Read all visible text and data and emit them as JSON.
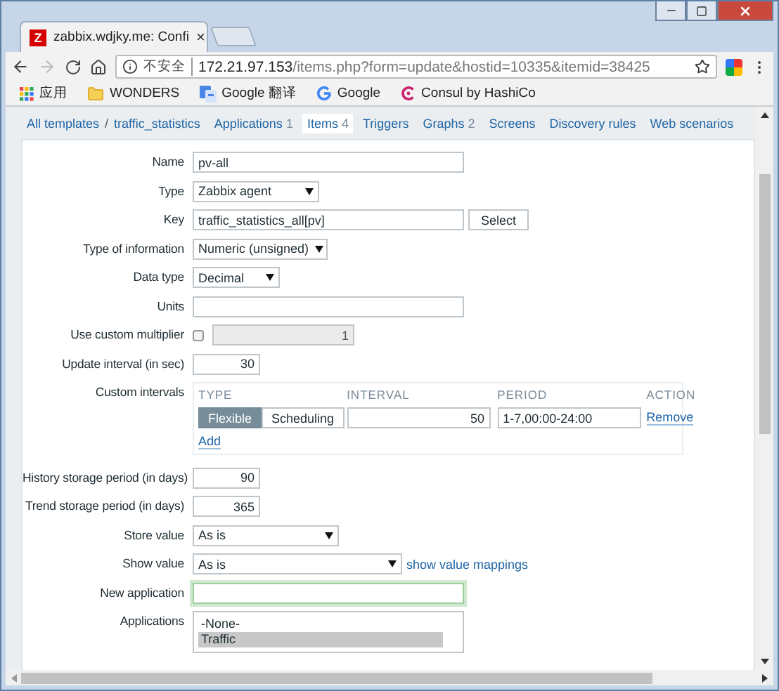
{
  "browser": {
    "tab": {
      "favicon": "Z",
      "title": "zabbix.wdjky.me: Confi",
      "close": "×"
    },
    "address": {
      "security": "不安全",
      "host": "172.21.97.153",
      "path": "/items.php?form=update&hostid=10335&itemid=38425"
    },
    "bookmarks": [
      {
        "kind": "apps",
        "label": "应用"
      },
      {
        "kind": "folder",
        "label": "WONDERS"
      },
      {
        "kind": "translate",
        "label": "Google 翻译"
      },
      {
        "kind": "google",
        "label": "Google"
      },
      {
        "kind": "consul",
        "label": "Consul by HashiCo"
      }
    ]
  },
  "nav": [
    {
      "label": "All templates",
      "selected": false
    },
    {
      "label": "traffic_statistics",
      "selected": false,
      "separator": "/"
    },
    {
      "label": "Applications",
      "count": "1",
      "selected": false
    },
    {
      "label": "Items",
      "count": "4",
      "selected": true
    },
    {
      "label": "Triggers",
      "selected": false
    },
    {
      "label": "Graphs",
      "count": "2",
      "selected": false
    },
    {
      "label": "Screens",
      "selected": false
    },
    {
      "label": "Discovery rules",
      "selected": false
    },
    {
      "label": "Web scenarios",
      "selected": false
    }
  ],
  "form": [
    {
      "kind": "text",
      "label": "Name",
      "value": "pv-all"
    },
    {
      "kind": "select",
      "label": "Type",
      "value": "Zabbix agent"
    },
    {
      "kind": "text",
      "label": "Key",
      "value": "traffic_statistics_all[pv]",
      "button": "Select"
    },
    {
      "kind": "select",
      "label": "Type of information",
      "value": "Numeric (unsigned)"
    },
    {
      "kind": "select",
      "label": "Data type",
      "value": "Decimal"
    },
    {
      "kind": "text",
      "label": "Units"
    },
    {
      "kind": "checkbox",
      "label": "Use custom multiplier",
      "checked": false,
      "value": "1"
    },
    {
      "kind": "number",
      "label": "Update interval (in sec)",
      "value": "30"
    },
    {
      "kind": "intervals",
      "label": "Custom intervals",
      "columns": [
        "TYPE",
        "INTERVAL",
        "PERIOD",
        "ACTION"
      ],
      "rows": [
        {
          "modes": [
            {
              "label": "Flexible",
              "selected": true
            },
            {
              "label": "Scheduling",
              "selected": false
            }
          ],
          "interval": "50",
          "period": "1-7,00:00-24:00",
          "action": "Remove"
        }
      ],
      "add": "Add"
    },
    {
      "kind": "number",
      "label": "History storage period (in days)",
      "value": "90"
    },
    {
      "kind": "number",
      "label": "Trend storage period (in days)",
      "value": "365"
    },
    {
      "kind": "select",
      "label": "Store value",
      "value": "As is"
    },
    {
      "kind": "select",
      "label": "Show value",
      "value": "As is",
      "link": "show value mappings"
    },
    {
      "kind": "text",
      "label": "New application",
      "focused": true
    },
    {
      "kind": "list",
      "label": "Applications",
      "options": [
        {
          "label": "-None-",
          "selected": false
        },
        {
          "label": "Traffic",
          "selected": true
        }
      ]
    }
  ]
}
